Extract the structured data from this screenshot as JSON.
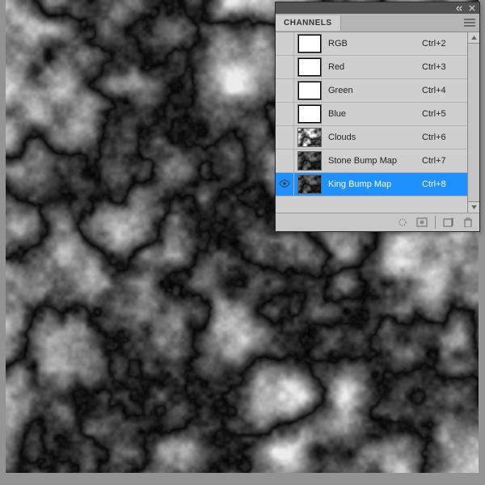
{
  "panel": {
    "tab_label": "CHANNELS",
    "channels": [
      {
        "name": "RGB",
        "shortcut": "Ctrl+2",
        "visible": false,
        "thumb": "white",
        "selected": false
      },
      {
        "name": "Red",
        "shortcut": "Ctrl+3",
        "visible": false,
        "thumb": "white",
        "selected": false
      },
      {
        "name": "Green",
        "shortcut": "Ctrl+4",
        "visible": false,
        "thumb": "white",
        "selected": false
      },
      {
        "name": "Blue",
        "shortcut": "Ctrl+5",
        "visible": false,
        "thumb": "white",
        "selected": false
      },
      {
        "name": "Clouds",
        "shortcut": "Ctrl+6",
        "visible": false,
        "thumb": "clouds-light",
        "selected": false
      },
      {
        "name": "Stone Bump Map",
        "shortcut": "Ctrl+7",
        "visible": false,
        "thumb": "clouds-dark",
        "selected": false
      },
      {
        "name": "King Bump Map",
        "shortcut": "Ctrl+8",
        "visible": true,
        "thumb": "clouds-dark",
        "selected": true
      }
    ]
  }
}
